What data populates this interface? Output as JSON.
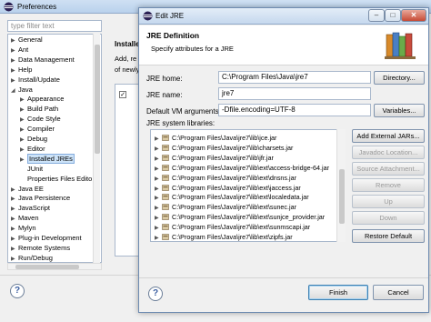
{
  "preferences": {
    "title": "Preferences",
    "filter_placeholder": "type filter text",
    "tree": [
      {
        "label": "General",
        "depth": 0,
        "expander": "▶"
      },
      {
        "label": "Ant",
        "depth": 0,
        "expander": "▶"
      },
      {
        "label": "Data Management",
        "depth": 0,
        "expander": "▶"
      },
      {
        "label": "Help",
        "depth": 0,
        "expander": "▶"
      },
      {
        "label": "Install/Update",
        "depth": 0,
        "expander": "▶"
      },
      {
        "label": "Java",
        "depth": 0,
        "expander": "◢"
      },
      {
        "label": "Appearance",
        "depth": 1,
        "expander": "▶"
      },
      {
        "label": "Build Path",
        "depth": 1,
        "expander": "▶"
      },
      {
        "label": "Code Style",
        "depth": 1,
        "expander": "▶"
      },
      {
        "label": "Compiler",
        "depth": 1,
        "expander": "▶"
      },
      {
        "label": "Debug",
        "depth": 1,
        "expander": "▶"
      },
      {
        "label": "Editor",
        "depth": 1,
        "expander": "▶"
      },
      {
        "label": "Installed JREs",
        "depth": 1,
        "expander": "▶",
        "selected": true
      },
      {
        "label": "JUnit",
        "depth": 1,
        "expander": ""
      },
      {
        "label": "Properties Files Edito",
        "depth": 1,
        "expander": ""
      },
      {
        "label": "Java EE",
        "depth": 0,
        "expander": "▶"
      },
      {
        "label": "Java Persistence",
        "depth": 0,
        "expander": "▶"
      },
      {
        "label": "JavaScript",
        "depth": 0,
        "expander": "▶"
      },
      {
        "label": "Maven",
        "depth": 0,
        "expander": "▶"
      },
      {
        "label": "Mylyn",
        "depth": 0,
        "expander": "▶"
      },
      {
        "label": "Plug-in Development",
        "depth": 0,
        "expander": "▶"
      },
      {
        "label": "Remote Systems",
        "depth": 0,
        "expander": "▶"
      },
      {
        "label": "Run/Debug",
        "depth": 0,
        "expander": "▶"
      }
    ],
    "page_title": "Installed",
    "page_line1": "Add, re",
    "page_line2": "of newly"
  },
  "dialog": {
    "title": "Edit JRE",
    "header_title": "JRE Definition",
    "header_subtitle": "Specify attributes for a JRE",
    "jre_home_label": "JRE home:",
    "jre_home_value": "C:\\Program Files\\Java\\jre7",
    "jre_name_label": "JRE name:",
    "jre_name_value": "jre7",
    "vm_args_label": "Default VM arguments:",
    "vm_args_value": "-Dfile.encoding=UTF-8",
    "libraries_label": "JRE system libraries:",
    "libraries": [
      "C:\\Program Files\\Java\\jre7\\lib\\jce.jar",
      "C:\\Program Files\\Java\\jre7\\lib\\charsets.jar",
      "C:\\Program Files\\Java\\jre7\\lib\\jfr.jar",
      "C:\\Program Files\\Java\\jre7\\lib\\ext\\access-bridge-64.jar",
      "C:\\Program Files\\Java\\jre7\\lib\\ext\\dnsns.jar",
      "C:\\Program Files\\Java\\jre7\\lib\\ext\\jaccess.jar",
      "C:\\Program Files\\Java\\jre7\\lib\\ext\\localedata.jar",
      "C:\\Program Files\\Java\\jre7\\lib\\ext\\sunec.jar",
      "C:\\Program Files\\Java\\jre7\\lib\\ext\\sunjce_provider.jar",
      "C:\\Program Files\\Java\\jre7\\lib\\ext\\sunmscapi.jar",
      "C:\\Program Files\\Java\\jre7\\lib\\ext\\zipfs.jar"
    ],
    "buttons": {
      "directory": "Directory...",
      "variables": "Variables...",
      "add_external_jars": "Add External JARs...",
      "javadoc_location": "Javadoc Location...",
      "source_attachment": "Source Attachment...",
      "remove": "Remove",
      "up": "Up",
      "down": "Down",
      "restore_default": "Restore Default",
      "finish": "Finish",
      "cancel": "Cancel"
    }
  },
  "colors": {
    "accent": "#3c7fb1",
    "selection": "#cde3f8",
    "disabled_text": "#9a9a9a"
  }
}
